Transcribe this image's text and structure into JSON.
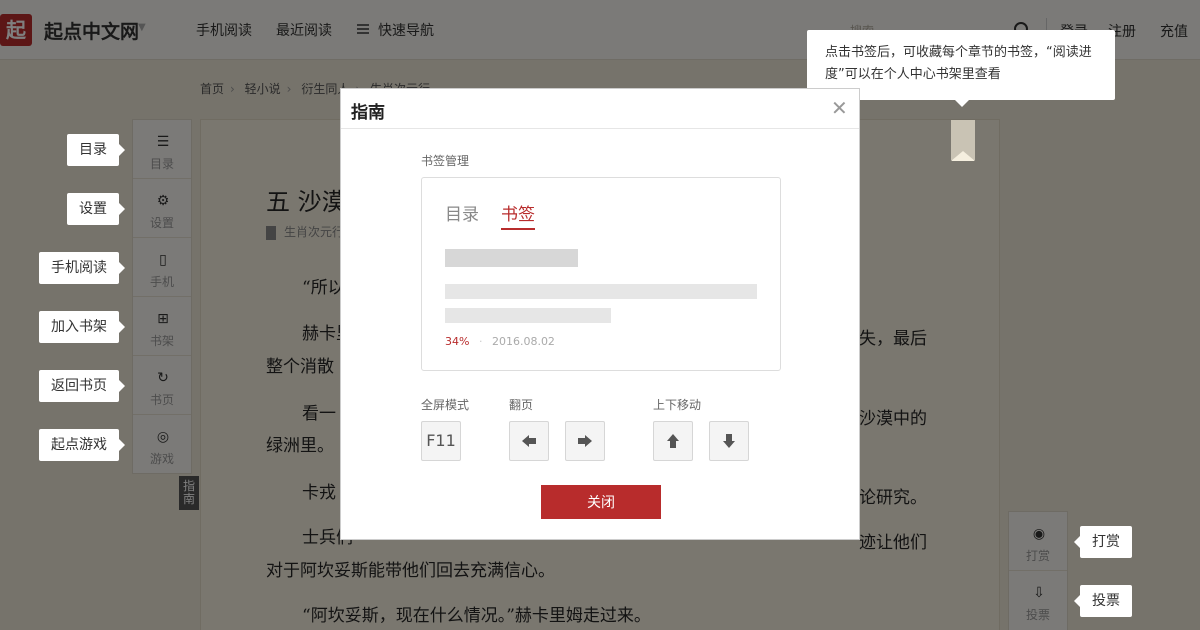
{
  "header": {
    "logo_char": "起",
    "site_name": "起点中文网",
    "nav": [
      "手机阅读",
      "最近阅读",
      "快速导航"
    ],
    "search_placeholder": "搜索",
    "login": "登录",
    "register": "注册",
    "recharge": "充值"
  },
  "breadcrumb": [
    "首页",
    "轻小说",
    "衍生同人",
    "生肖次元行"
  ],
  "chapter": {
    "title": "五 沙漠",
    "meta": "生肖次元行",
    "paragraphs": [
      "“所以",
      "赫卡里",
      "整个消散",
      "看一",
      "绿洲里。",
      "卡戎",
      "士兵们",
      "对于阿坎妥斯能带他们回去充满信心。",
      "“阿坎妥斯，现在什么情况。”赫卡里姆走过来。"
    ],
    "paragraph_ends": [
      "失，最后",
      "沙漠中的",
      "论研究。",
      "迹让他们"
    ]
  },
  "left_sidebar": {
    "items": [
      {
        "label": "目录",
        "tip": "目录"
      },
      {
        "label": "设置",
        "tip": "设置"
      },
      {
        "label": "手机",
        "tip": "手机阅读"
      },
      {
        "label": "书架",
        "tip": "加入书架"
      },
      {
        "label": "书页",
        "tip": "返回书页"
      },
      {
        "label": "游戏",
        "tip": "起点游戏"
      }
    ],
    "guide_tab": "指南"
  },
  "right_sidebar": {
    "items": [
      {
        "label": "打赏",
        "tip": "打赏"
      },
      {
        "label": "投票",
        "tip": "投票"
      }
    ]
  },
  "bookmark_tip": "点击书签后，可收藏每个章节的书签，“阅读进度”可以在个人中心书架里查看",
  "dialog": {
    "title": "指南",
    "section_bookmark": "书签管理",
    "tab_catalog": "目录",
    "tab_bookmark": "书签",
    "progress": "34%",
    "dot": "·",
    "date": "2016.08.02",
    "label_fullscreen": "全屏模式",
    "label_page": "翻页",
    "label_scroll": "上下移动",
    "key_f11": "F11",
    "close_label": "关闭"
  },
  "colors": {
    "accent": "#b82c2c",
    "page_bg": "#f5efdf"
  }
}
